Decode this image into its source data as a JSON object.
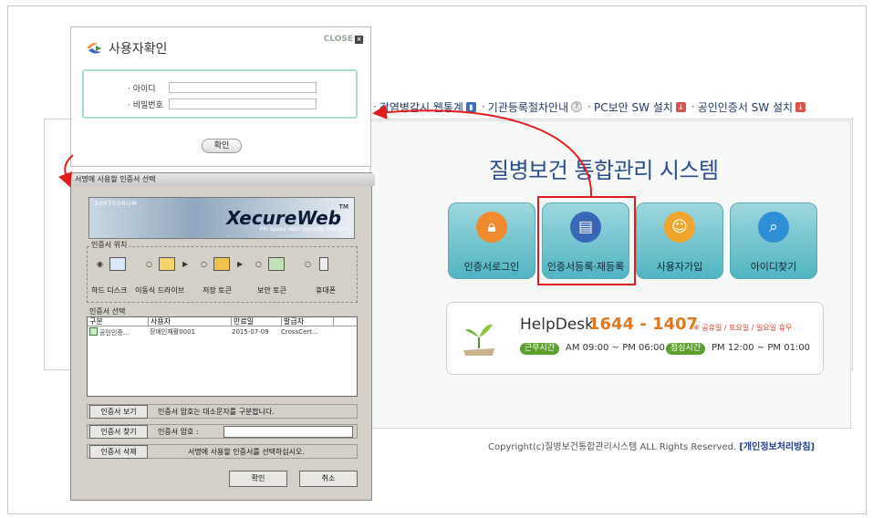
{
  "background_page": {
    "nav": [
      {
        "label": "감염병감시 웹통계",
        "icon": "chart-icon"
      },
      {
        "label": "기관등록절차안내",
        "icon": "help-icon"
      },
      {
        "label": "PC보안 SW 설치",
        "icon": "download-icon"
      },
      {
        "label": "공인인증서 SW 설치",
        "icon": "download-icon"
      }
    ],
    "system_title": "질병보건 통합관리 시스템",
    "tiles": [
      {
        "label": "인증서로그인",
        "icon": "lock-icon"
      },
      {
        "label": "인증서등록·재등록",
        "icon": "document-icon"
      },
      {
        "label": "사용자가입",
        "icon": "users-icon"
      },
      {
        "label": "아이디찾기",
        "icon": "search-icon"
      }
    ],
    "helpdesk": {
      "title": "HelpDesk",
      "number": "1644 - 1407",
      "note": "※ 공휴일 / 토요일 / 일요일 휴무",
      "work_label": "근무시간",
      "work_hours": "AM 09:00 ~ PM 06:00",
      "lunch_label": "점심시간",
      "lunch_hours": "PM 12:00 ~ PM 01:00"
    },
    "copyright": "Copyright(c)질병보건통합관리시스템 ALL Rights Reserved.",
    "privacy_link": "[개인정보처리방침]"
  },
  "user_dialog": {
    "title": "사용자확인",
    "close_label": "CLOSE",
    "id_label": "· 아이디",
    "pw_label": "· 비밀번호",
    "id_value": "",
    "pw_value": "",
    "confirm_label": "확인"
  },
  "cert_dialog": {
    "title": "서명에 사용할 인증서 선택",
    "banner_vendor": "SOFTFORUM",
    "banner_product": "XecureWeb",
    "banner_tm": "TM",
    "banner_tagline": "PKI based Web Security Solution",
    "location_label": "인증서 위치",
    "devices": [
      "하드 디스크",
      "이동식 드라이브",
      "저장 토큰",
      "보안 토큰",
      "휴대폰"
    ],
    "list_label": "인증서 선택",
    "columns": [
      "구분",
      "사용자",
      "만료일",
      "발급자"
    ],
    "rows": [
      {
        "type": "공인인증...",
        "user": "장애인재활0001",
        "expiry": "2015-07-09",
        "issuer": "CrossCert..."
      }
    ],
    "view_button": "인증서 보기",
    "find_button": "인증서 찾기",
    "delete_button": "인증서 삭제",
    "case_note": "인증서 암호는 대소문자를 구분합니다.",
    "pw_label": "인증서 암호 :",
    "pw_value": "",
    "select_note": "서명에 사용할 인증서를 선택하십시오.",
    "ok_button": "확인",
    "cancel_button": "취소"
  },
  "colors": {
    "annotation_red": "#e21b1b",
    "tile_teal": "#4fb4c2",
    "title_blue": "#2a4e8a",
    "helpdesk_orange": "#e0781e"
  }
}
